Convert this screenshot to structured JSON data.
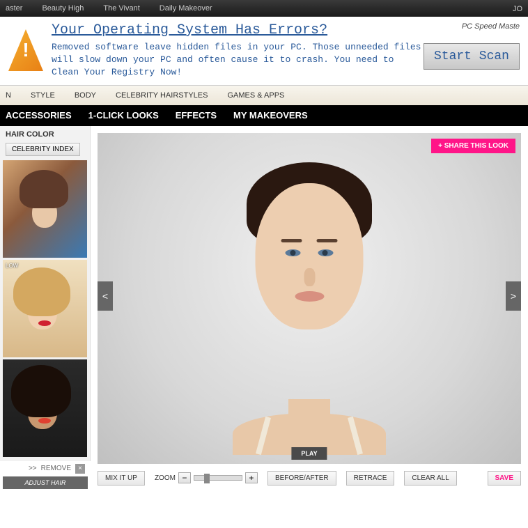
{
  "topbar": {
    "links": [
      "aster",
      "Beauty High",
      "The Vivant",
      "Daily Makeover"
    ],
    "right": "JO"
  },
  "ad": {
    "title": "Your Operating System Has Errors?",
    "body": "Removed software leave hidden files in your PC. Those unneeded files will slow down your PC and often cause it to crash. You need to Clean Your Registry Now!",
    "brand": "PC Speed Maste",
    "button": "Start Scan"
  },
  "nav1": {
    "items": [
      "N",
      "STYLE",
      "BODY",
      "CELEBRITY HAIRSTYLES",
      "GAMES & APPS"
    ]
  },
  "nav2": {
    "items": [
      "ACCESSORIES",
      "1-CLICK LOOKS",
      "EFFECTS",
      "MY MAKEOVERS"
    ]
  },
  "sidebar": {
    "title": "HAIR COLOR",
    "celeb_index": "CELEBRITY INDEX",
    "thumbs": [
      {
        "label": ""
      },
      {
        "label": "LOW"
      },
      {
        "label": ""
      }
    ]
  },
  "bottom": {
    "arrows": ">>",
    "remove": "REMOVE",
    "adjust": "ADJUST HAIR"
  },
  "canvas": {
    "share": "+ SHARE THIS LOOK",
    "prev": "<",
    "next": ">",
    "play": "PLAY"
  },
  "toolbar": {
    "mix": "MIX IT UP",
    "zoom_label": "ZOOM",
    "zoom_out": "−",
    "zoom_in": "+",
    "before_after": "BEFORE/AFTER",
    "retrace": "RETRACE",
    "clear": "CLEAR ALL",
    "save": "SAVE"
  }
}
